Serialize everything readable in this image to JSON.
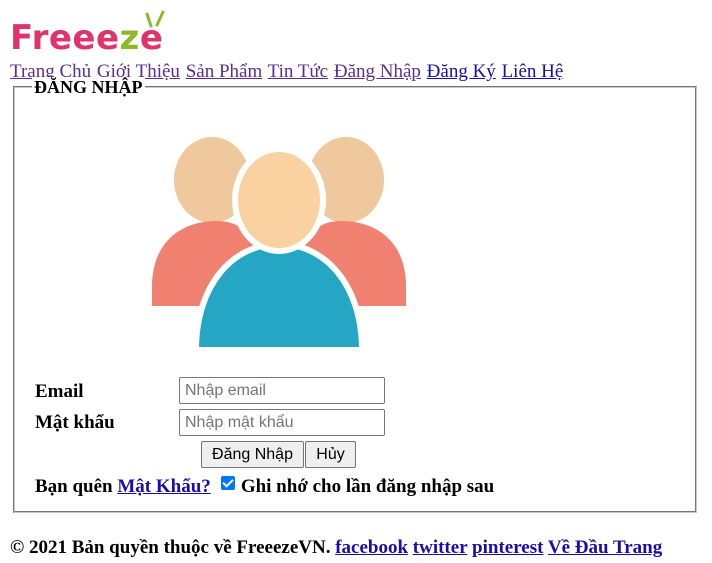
{
  "brand": {
    "logo_letters": [
      "F",
      "r",
      "e",
      "e",
      "e",
      "z",
      "e"
    ],
    "logo_color": "#e0336b",
    "accent_color": "#8db82c"
  },
  "nav": {
    "items": [
      "Trang Chủ",
      "Giới Thiệu",
      "Sản Phẩm",
      "Tin Tức",
      "Đăng Nhập",
      "Đăng Ký",
      "Liên Hệ"
    ]
  },
  "login": {
    "legend": "ĐĂNG NHẬP",
    "avatar_icon": "users-group-icon",
    "email_label": "Email",
    "email_placeholder": "Nhập email",
    "email_value": "",
    "password_label": "Mật khẩu",
    "password_placeholder": "Nhập mật khẩu",
    "password_value": "",
    "submit_label": "Đăng Nhập",
    "cancel_label": "Hủy",
    "forgot_prefix": "Bạn quên",
    "forgot_link": "Mật Khẩu?",
    "remember_checked": true,
    "remember_label": "Ghi nhớ cho lần đăng nhập sau"
  },
  "footer": {
    "copyright": "© 2021 Bản quyền thuộc về FreeezeVN.",
    "links": [
      "facebook",
      "twitter",
      "pinterest",
      "Về Đầu Trang"
    ]
  }
}
